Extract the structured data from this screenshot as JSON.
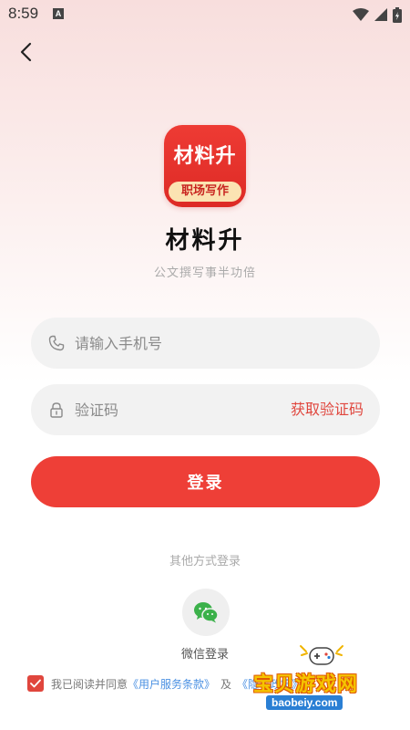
{
  "status_bar": {
    "time": "8:59",
    "notification_icon": "a-square-icon",
    "icons": [
      "wifi-icon",
      "signal-icon",
      "battery-icon"
    ]
  },
  "nav": {
    "back_icon": "chevron-left-icon"
  },
  "app": {
    "logo_text": "材料升",
    "logo_ribbon": "职场写作",
    "name": "材料升",
    "tagline": "公文撰写事半功倍"
  },
  "form": {
    "phone_placeholder": "请输入手机号",
    "phone_value": "",
    "phone_icon": "phone-icon",
    "code_placeholder": "验证码",
    "code_value": "",
    "code_icon": "lock-icon",
    "get_code_label": "获取验证码",
    "login_label": "登录"
  },
  "other_login": {
    "title": "其他方式登录",
    "wechat_icon": "wechat-icon",
    "wechat_label": "微信登录"
  },
  "agreement": {
    "checked": true,
    "prefix": "我已阅读并同意",
    "terms_link": "《用户服务条款》",
    "separator": "及",
    "privacy_link": "《隐私政策》"
  },
  "watermark": {
    "brand": "宝贝游戏网",
    "domain": "baobeiy.com"
  },
  "colors": {
    "primary": "#ee3f37",
    "link": "#4a90e2",
    "field_bg": "#f2f2f2",
    "watermark_yellow": "#f5c400",
    "watermark_blue": "#2a7fd4"
  }
}
